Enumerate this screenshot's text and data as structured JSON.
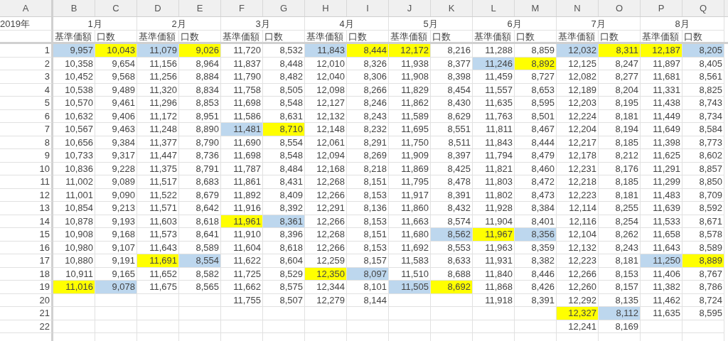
{
  "column_letters": [
    "A",
    "B",
    "C",
    "D",
    "E",
    "F",
    "G",
    "H",
    "I",
    "J",
    "K",
    "L",
    "M",
    "N",
    "O",
    "P",
    "Q"
  ],
  "year": "2019年",
  "row_numbers": [
    "1",
    "2",
    "3",
    "4",
    "5",
    "6",
    "7",
    "8",
    "9",
    "10",
    "11",
    "12",
    "13",
    "14",
    "15",
    "16",
    "17",
    "18",
    "19",
    "20",
    "21",
    "22"
  ],
  "months": [
    {
      "name": "1月",
      "headers": [
        "基準価額",
        "口数"
      ],
      "rows": [
        [
          {
            "text": "9,957",
            "color": "#bdd7ee"
          },
          {
            "text": "10,043",
            "color": "#ffff00"
          }
        ],
        [
          {
            "text": "10,358"
          },
          {
            "text": "9,654"
          }
        ],
        [
          {
            "text": "10,452"
          },
          {
            "text": "9,568"
          }
        ],
        [
          {
            "text": "10,538"
          },
          {
            "text": "9,489"
          }
        ],
        [
          {
            "text": "10,570"
          },
          {
            "text": "9,461"
          }
        ],
        [
          {
            "text": "10,632"
          },
          {
            "text": "9,406"
          }
        ],
        [
          {
            "text": "10,567"
          },
          {
            "text": "9,463"
          }
        ],
        [
          {
            "text": "10,656"
          },
          {
            "text": "9,384"
          }
        ],
        [
          {
            "text": "10,733"
          },
          {
            "text": "9,317"
          }
        ],
        [
          {
            "text": "10,836"
          },
          {
            "text": "9,228"
          }
        ],
        [
          {
            "text": "11,002"
          },
          {
            "text": "9,089"
          }
        ],
        [
          {
            "text": "11,001"
          },
          {
            "text": "9,090"
          }
        ],
        [
          {
            "text": "10,854"
          },
          {
            "text": "9,213"
          }
        ],
        [
          {
            "text": "10,878"
          },
          {
            "text": "9,193"
          }
        ],
        [
          {
            "text": "10,908"
          },
          {
            "text": "9,168"
          }
        ],
        [
          {
            "text": "10,980"
          },
          {
            "text": "9,107"
          }
        ],
        [
          {
            "text": "10,880"
          },
          {
            "text": "9,191"
          }
        ],
        [
          {
            "text": "10,911"
          },
          {
            "text": "9,165"
          }
        ],
        [
          {
            "text": "11,016",
            "color": "#ffff00"
          },
          {
            "text": "9,078",
            "color": "#bdd7ee"
          }
        ]
      ]
    },
    {
      "name": "2月",
      "headers": [
        "基準価額",
        "口数"
      ],
      "rows": [
        [
          {
            "text": "11,079",
            "color": "#bdd7ee"
          },
          {
            "text": "9,026",
            "color": "#ffff00"
          }
        ],
        [
          {
            "text": "11,156"
          },
          {
            "text": "8,964"
          }
        ],
        [
          {
            "text": "11,256"
          },
          {
            "text": "8,884"
          }
        ],
        [
          {
            "text": "11,320"
          },
          {
            "text": "8,834"
          }
        ],
        [
          {
            "text": "11,296"
          },
          {
            "text": "8,853"
          }
        ],
        [
          {
            "text": "11,172"
          },
          {
            "text": "8,951"
          }
        ],
        [
          {
            "text": "11,248"
          },
          {
            "text": "8,890"
          }
        ],
        [
          {
            "text": "11,377"
          },
          {
            "text": "8,790"
          }
        ],
        [
          {
            "text": "11,447"
          },
          {
            "text": "8,736"
          }
        ],
        [
          {
            "text": "11,375"
          },
          {
            "text": "8,791"
          }
        ],
        [
          {
            "text": "11,517"
          },
          {
            "text": "8,683"
          }
        ],
        [
          {
            "text": "11,522"
          },
          {
            "text": "8,679"
          }
        ],
        [
          {
            "text": "11,571"
          },
          {
            "text": "8,642"
          }
        ],
        [
          {
            "text": "11,603"
          },
          {
            "text": "8,618"
          }
        ],
        [
          {
            "text": "11,573"
          },
          {
            "text": "8,641"
          }
        ],
        [
          {
            "text": "11,643"
          },
          {
            "text": "8,589"
          }
        ],
        [
          {
            "text": "11,691",
            "color": "#ffff00"
          },
          {
            "text": "8,554",
            "color": "#bdd7ee"
          }
        ],
        [
          {
            "text": "11,652"
          },
          {
            "text": "8,582"
          }
        ],
        [
          {
            "text": "11,675"
          },
          {
            "text": "8,565"
          }
        ]
      ]
    },
    {
      "name": "3月",
      "headers": [
        "基準価額",
        "口数"
      ],
      "rows": [
        [
          {
            "text": "11,720"
          },
          {
            "text": "8,532"
          }
        ],
        [
          {
            "text": "11,837"
          },
          {
            "text": "8,448"
          }
        ],
        [
          {
            "text": "11,790"
          },
          {
            "text": "8,482"
          }
        ],
        [
          {
            "text": "11,758"
          },
          {
            "text": "8,505"
          }
        ],
        [
          {
            "text": "11,698"
          },
          {
            "text": "8,548"
          }
        ],
        [
          {
            "text": "11,586"
          },
          {
            "text": "8,631"
          }
        ],
        [
          {
            "text": "11,481",
            "color": "#bdd7ee"
          },
          {
            "text": "8,710",
            "color": "#ffff00"
          }
        ],
        [
          {
            "text": "11,690"
          },
          {
            "text": "8,554"
          }
        ],
        [
          {
            "text": "11,698"
          },
          {
            "text": "8,548"
          }
        ],
        [
          {
            "text": "11,787"
          },
          {
            "text": "8,484"
          }
        ],
        [
          {
            "text": "11,861"
          },
          {
            "text": "8,431"
          }
        ],
        [
          {
            "text": "11,892"
          },
          {
            "text": "8,409"
          }
        ],
        [
          {
            "text": "11,916"
          },
          {
            "text": "8,392"
          }
        ],
        [
          {
            "text": "11,961",
            "color": "#ffff00"
          },
          {
            "text": "8,361",
            "color": "#bdd7ee"
          }
        ],
        [
          {
            "text": "11,910"
          },
          {
            "text": "8,396"
          }
        ],
        [
          {
            "text": "11,604"
          },
          {
            "text": "8,618"
          }
        ],
        [
          {
            "text": "11,622"
          },
          {
            "text": "8,604"
          }
        ],
        [
          {
            "text": "11,725"
          },
          {
            "text": "8,529"
          }
        ],
        [
          {
            "text": "11,662"
          },
          {
            "text": "8,575"
          }
        ],
        [
          {
            "text": "11,755"
          },
          {
            "text": "8,507"
          }
        ]
      ]
    },
    {
      "name": "4月",
      "headers": [
        "基準価額",
        "口数"
      ],
      "rows": [
        [
          {
            "text": "11,843",
            "color": "#bdd7ee"
          },
          {
            "text": "8,444",
            "color": "#ffff00"
          }
        ],
        [
          {
            "text": "12,010"
          },
          {
            "text": "8,326"
          }
        ],
        [
          {
            "text": "12,040"
          },
          {
            "text": "8,306"
          }
        ],
        [
          {
            "text": "12,098"
          },
          {
            "text": "8,266"
          }
        ],
        [
          {
            "text": "12,127"
          },
          {
            "text": "8,246"
          }
        ],
        [
          {
            "text": "12,132"
          },
          {
            "text": "8,243"
          }
        ],
        [
          {
            "text": "12,148"
          },
          {
            "text": "8,232"
          }
        ],
        [
          {
            "text": "12,061"
          },
          {
            "text": "8,291"
          }
        ],
        [
          {
            "text": "12,094"
          },
          {
            "text": "8,269"
          }
        ],
        [
          {
            "text": "12,168"
          },
          {
            "text": "8,218"
          }
        ],
        [
          {
            "text": "12,268"
          },
          {
            "text": "8,151"
          }
        ],
        [
          {
            "text": "12,266"
          },
          {
            "text": "8,153"
          }
        ],
        [
          {
            "text": "12,291"
          },
          {
            "text": "8,136"
          }
        ],
        [
          {
            "text": "12,266"
          },
          {
            "text": "8,153"
          }
        ],
        [
          {
            "text": "12,268"
          },
          {
            "text": "8,151"
          }
        ],
        [
          {
            "text": "12,266"
          },
          {
            "text": "8,153"
          }
        ],
        [
          {
            "text": "12,259"
          },
          {
            "text": "8,157"
          }
        ],
        [
          {
            "text": "12,350",
            "color": "#ffff00"
          },
          {
            "text": "8,097",
            "color": "#bdd7ee"
          }
        ],
        [
          {
            "text": "12,344"
          },
          {
            "text": "8,101"
          }
        ],
        [
          {
            "text": "12,279"
          },
          {
            "text": "8,144"
          }
        ]
      ]
    },
    {
      "name": "5月",
      "headers": [
        "基準価額",
        "口数"
      ],
      "rows": [
        [
          {
            "text": "12,172",
            "color": "#ffff00"
          },
          {
            "text": "8,216"
          }
        ],
        [
          {
            "text": "11,938"
          },
          {
            "text": "8,377"
          }
        ],
        [
          {
            "text": "11,908"
          },
          {
            "text": "8,398"
          }
        ],
        [
          {
            "text": "11,829"
          },
          {
            "text": "8,454"
          }
        ],
        [
          {
            "text": "11,862"
          },
          {
            "text": "8,430"
          }
        ],
        [
          {
            "text": "11,589"
          },
          {
            "text": "8,629"
          }
        ],
        [
          {
            "text": "11,695"
          },
          {
            "text": "8,551"
          }
        ],
        [
          {
            "text": "11,750"
          },
          {
            "text": "8,511"
          }
        ],
        [
          {
            "text": "11,909"
          },
          {
            "text": "8,397"
          }
        ],
        [
          {
            "text": "11,869"
          },
          {
            "text": "8,425"
          }
        ],
        [
          {
            "text": "11,795"
          },
          {
            "text": "8,478"
          }
        ],
        [
          {
            "text": "11,917"
          },
          {
            "text": "8,391"
          }
        ],
        [
          {
            "text": "11,860"
          },
          {
            "text": "8,432"
          }
        ],
        [
          {
            "text": "11,663"
          },
          {
            "text": "8,574"
          }
        ],
        [
          {
            "text": "11,680"
          },
          {
            "text": "8,562",
            "color": "#bdd7ee"
          }
        ],
        [
          {
            "text": "11,692"
          },
          {
            "text": "8,553"
          }
        ],
        [
          {
            "text": "11,583"
          },
          {
            "text": "8,633"
          }
        ],
        [
          {
            "text": "11,510"
          },
          {
            "text": "8,688"
          }
        ],
        [
          {
            "text": "11,505",
            "color": "#bdd7ee"
          },
          {
            "text": "8,692",
            "color": "#ffff00"
          }
        ]
      ]
    },
    {
      "name": "6月",
      "headers": [
        "基準価額",
        "口数"
      ],
      "rows": [
        [
          {
            "text": "11,288"
          },
          {
            "text": "8,859"
          }
        ],
        [
          {
            "text": "11,246",
            "color": "#bdd7ee"
          },
          {
            "text": "8,892",
            "color": "#ffff00"
          }
        ],
        [
          {
            "text": "11,459"
          },
          {
            "text": "8,727"
          }
        ],
        [
          {
            "text": "11,557"
          },
          {
            "text": "8,653"
          }
        ],
        [
          {
            "text": "11,635"
          },
          {
            "text": "8,595"
          }
        ],
        [
          {
            "text": "11,763"
          },
          {
            "text": "8,501"
          }
        ],
        [
          {
            "text": "11,811"
          },
          {
            "text": "8,467"
          }
        ],
        [
          {
            "text": "11,843"
          },
          {
            "text": "8,444"
          }
        ],
        [
          {
            "text": "11,794"
          },
          {
            "text": "8,479"
          }
        ],
        [
          {
            "text": "11,821"
          },
          {
            "text": "8,460"
          }
        ],
        [
          {
            "text": "11,803"
          },
          {
            "text": "8,472"
          }
        ],
        [
          {
            "text": "11,802"
          },
          {
            "text": "8,473"
          }
        ],
        [
          {
            "text": "11,928"
          },
          {
            "text": "8,384"
          }
        ],
        [
          {
            "text": "11,904"
          },
          {
            "text": "8,401"
          }
        ],
        [
          {
            "text": "11,967",
            "color": "#ffff00"
          },
          {
            "text": "8,356",
            "color": "#bdd7ee"
          }
        ],
        [
          {
            "text": "11,963"
          },
          {
            "text": "8,359"
          }
        ],
        [
          {
            "text": "11,931"
          },
          {
            "text": "8,382"
          }
        ],
        [
          {
            "text": "11,840"
          },
          {
            "text": "8,446"
          }
        ],
        [
          {
            "text": "11,868"
          },
          {
            "text": "8,426"
          }
        ],
        [
          {
            "text": "11,918"
          },
          {
            "text": "8,391"
          }
        ]
      ]
    },
    {
      "name": "7月",
      "headers": [
        "基準価額",
        "口数"
      ],
      "rows": [
        [
          {
            "text": "12,032",
            "color": "#bdd7ee"
          },
          {
            "text": "8,311",
            "color": "#ffff00"
          }
        ],
        [
          {
            "text": "12,125"
          },
          {
            "text": "8,247"
          }
        ],
        [
          {
            "text": "12,082"
          },
          {
            "text": "8,277"
          }
        ],
        [
          {
            "text": "12,189"
          },
          {
            "text": "8,204"
          }
        ],
        [
          {
            "text": "12,203"
          },
          {
            "text": "8,195"
          }
        ],
        [
          {
            "text": "12,224"
          },
          {
            "text": "8,181"
          }
        ],
        [
          {
            "text": "12,204"
          },
          {
            "text": "8,194"
          }
        ],
        [
          {
            "text": "12,217"
          },
          {
            "text": "8,185"
          }
        ],
        [
          {
            "text": "12,178"
          },
          {
            "text": "8,212"
          }
        ],
        [
          {
            "text": "12,231"
          },
          {
            "text": "8,176"
          }
        ],
        [
          {
            "text": "12,218"
          },
          {
            "text": "8,185"
          }
        ],
        [
          {
            "text": "12,223"
          },
          {
            "text": "8,181"
          }
        ],
        [
          {
            "text": "12,114"
          },
          {
            "text": "8,255"
          }
        ],
        [
          {
            "text": "12,116"
          },
          {
            "text": "8,254"
          }
        ],
        [
          {
            "text": "12,104"
          },
          {
            "text": "8,262"
          }
        ],
        [
          {
            "text": "12,132"
          },
          {
            "text": "8,243"
          }
        ],
        [
          {
            "text": "12,223"
          },
          {
            "text": "8,181"
          }
        ],
        [
          {
            "text": "12,266"
          },
          {
            "text": "8,153"
          }
        ],
        [
          {
            "text": "12,260"
          },
          {
            "text": "8,157"
          }
        ],
        [
          {
            "text": "12,292"
          },
          {
            "text": "8,135"
          }
        ],
        [
          {
            "text": "12,327",
            "color": "#ffff00"
          },
          {
            "text": "8,112",
            "color": "#bdd7ee"
          }
        ],
        [
          {
            "text": "12,241"
          },
          {
            "text": "8,169"
          }
        ]
      ]
    },
    {
      "name": "8月",
      "headers": [
        "基準価額",
        "口数"
      ],
      "rows": [
        [
          {
            "text": "12,187",
            "color": "#ffff00"
          },
          {
            "text": "8,205",
            "color": "#bdd7ee"
          }
        ],
        [
          {
            "text": "11,897"
          },
          {
            "text": "8,405"
          }
        ],
        [
          {
            "text": "11,681"
          },
          {
            "text": "8,561"
          }
        ],
        [
          {
            "text": "11,331"
          },
          {
            "text": "8,825"
          }
        ],
        [
          {
            "text": "11,438"
          },
          {
            "text": "8,743"
          }
        ],
        [
          {
            "text": "11,449"
          },
          {
            "text": "8,734"
          }
        ],
        [
          {
            "text": "11,649"
          },
          {
            "text": "8,584"
          }
        ],
        [
          {
            "text": "11,398"
          },
          {
            "text": "8,773"
          }
        ],
        [
          {
            "text": "11,625"
          },
          {
            "text": "8,602"
          }
        ],
        [
          {
            "text": "11,291"
          },
          {
            "text": "8,857"
          }
        ],
        [
          {
            "text": "11,299"
          },
          {
            "text": "8,850"
          }
        ],
        [
          {
            "text": "11,483"
          },
          {
            "text": "8,709"
          }
        ],
        [
          {
            "text": "11,639"
          },
          {
            "text": "8,592"
          }
        ],
        [
          {
            "text": "11,533"
          },
          {
            "text": "8,671"
          }
        ],
        [
          {
            "text": "11,658"
          },
          {
            "text": "8,578"
          }
        ],
        [
          {
            "text": "11,643"
          },
          {
            "text": "8,589"
          }
        ],
        [
          {
            "text": "11,250",
            "color": "#bdd7ee"
          },
          {
            "text": "8,889",
            "color": "#ffff00"
          }
        ],
        [
          {
            "text": "11,406"
          },
          {
            "text": "8,767"
          }
        ],
        [
          {
            "text": "11,382"
          },
          {
            "text": "8,786"
          }
        ],
        [
          {
            "text": "11,462"
          },
          {
            "text": "8,724"
          }
        ],
        [
          {
            "text": "11,635"
          },
          {
            "text": "8,595"
          }
        ]
      ]
    }
  ]
}
